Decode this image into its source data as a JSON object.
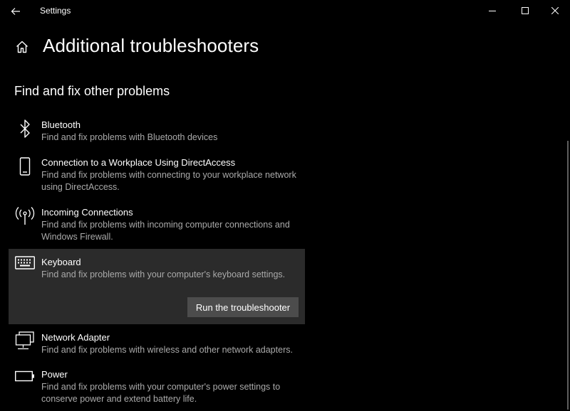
{
  "window": {
    "title": "Settings"
  },
  "page": {
    "title": "Additional troubleshooters",
    "section_heading": "Find and fix other problems"
  },
  "troubleshooters": [
    {
      "name": "Bluetooth",
      "description": "Find and fix problems with Bluetooth devices",
      "icon": "bluetooth-icon"
    },
    {
      "name": "Connection to a Workplace Using DirectAccess",
      "description": "Find and fix problems with connecting to your workplace network using DirectAccess.",
      "icon": "phone-icon"
    },
    {
      "name": "Incoming Connections",
      "description": "Find and fix problems with incoming computer connections and Windows Firewall.",
      "icon": "antenna-icon"
    },
    {
      "name": "Keyboard",
      "description": "Find and fix problems with your computer's keyboard settings.",
      "icon": "keyboard-icon",
      "selected": true,
      "action_label": "Run the troubleshooter"
    },
    {
      "name": "Network Adapter",
      "description": "Find and fix problems with wireless and other network adapters.",
      "icon": "network-adapter-icon"
    },
    {
      "name": "Power",
      "description": "Find and fix problems with your computer's power settings to conserve power and extend battery life.",
      "icon": "battery-icon"
    }
  ],
  "colors": {
    "background": "#000000",
    "selected_background": "#2b2b2b",
    "button_background": "#4c4c4c",
    "secondary_text": "#aaaaaa"
  }
}
